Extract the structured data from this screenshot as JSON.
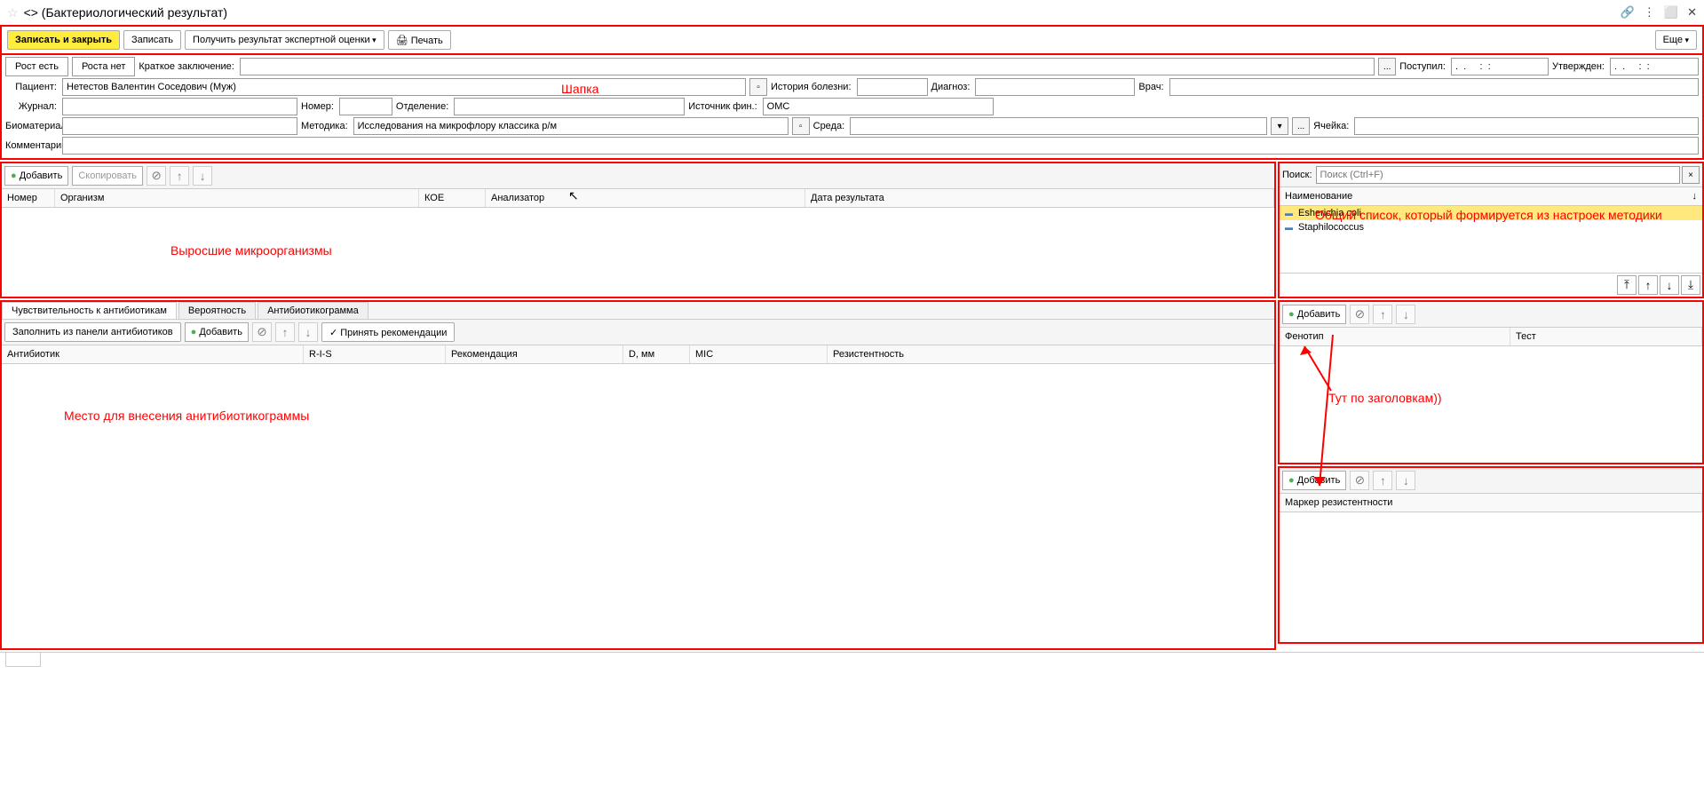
{
  "title": "<> (Бактериологический результат)",
  "title_icons": {
    "link": "🔗",
    "menu": "⋮",
    "maximize": "⬜",
    "close": "✕"
  },
  "toolbar": {
    "save_close": "Записать и закрыть",
    "save": "Записать",
    "expert": "Получить результат экспертной оценки",
    "print": "Печать",
    "more": "Еще"
  },
  "growth": {
    "yes": "Рост есть",
    "no": "Роста нет"
  },
  "header": {
    "short_conclusion_label": "Краткое заключение:",
    "received_label": "Поступил:",
    "received_value": ".  .     :  :",
    "approved_label": "Утвержден:",
    "approved_value": ".  .     :  :",
    "patient_label": "Пациент:",
    "patient_value": "Нетестов Валентин Соседович (Муж)",
    "history_label": "История болезни:",
    "diagnosis_label": "Диагноз:",
    "doctor_label": "Врач:",
    "journal_label": "Журнал:",
    "number_label": "Номер:",
    "department_label": "Отделение:",
    "funding_label": "Источник фин.:",
    "funding_value": "ОМС",
    "biomaterial_label": "Биоматериал:",
    "method_label": "Методика:",
    "method_value": "Исследования на микрофлору классика р/м",
    "medium_label": "Среда:",
    "cell_label": "Ячейка:",
    "comment_label": "Комментарий:"
  },
  "annotation_header": "Шапка",
  "organisms": {
    "add": "Добавить",
    "copy": "Скопировать",
    "cols": {
      "number": "Номер",
      "organism": "Организм",
      "koe": "КОЕ",
      "analyzer": "Анализатор",
      "result_date": "Дата результата"
    },
    "annotation": "Выросшие микроорганизмы"
  },
  "refs": {
    "search_label": "Поиск:",
    "search_placeholder": "Поиск (Ctrl+F)",
    "name_col": "Наименование",
    "items": [
      "Esherichia coli",
      "Staphilococcus"
    ],
    "annotation": "Общий список, который формируется из настроек методики"
  },
  "antibio": {
    "tabs": {
      "sens": "Чувствительность к антибиотикам",
      "prob": "Вероятность",
      "gram": "Антибиотикограмма"
    },
    "fill": "Заполнить из панели антибиотиков",
    "add": "Добавить",
    "accept": "Принять рекомендации",
    "cols": {
      "antibiotic": "Антибиотик",
      "ris": "R-I-S",
      "recom": "Рекомендация",
      "dmm": "D, мм",
      "mic": "MIC",
      "resist": "Резистентность"
    },
    "annotation": "Место для внесения анитибиотикограммы"
  },
  "pheno": {
    "add": "Добавить",
    "cols": {
      "phenotype": "Фенотип",
      "test": "Тест"
    },
    "annotation": "Тут по заголовкам))",
    "marker": "Маркер резистентности"
  }
}
